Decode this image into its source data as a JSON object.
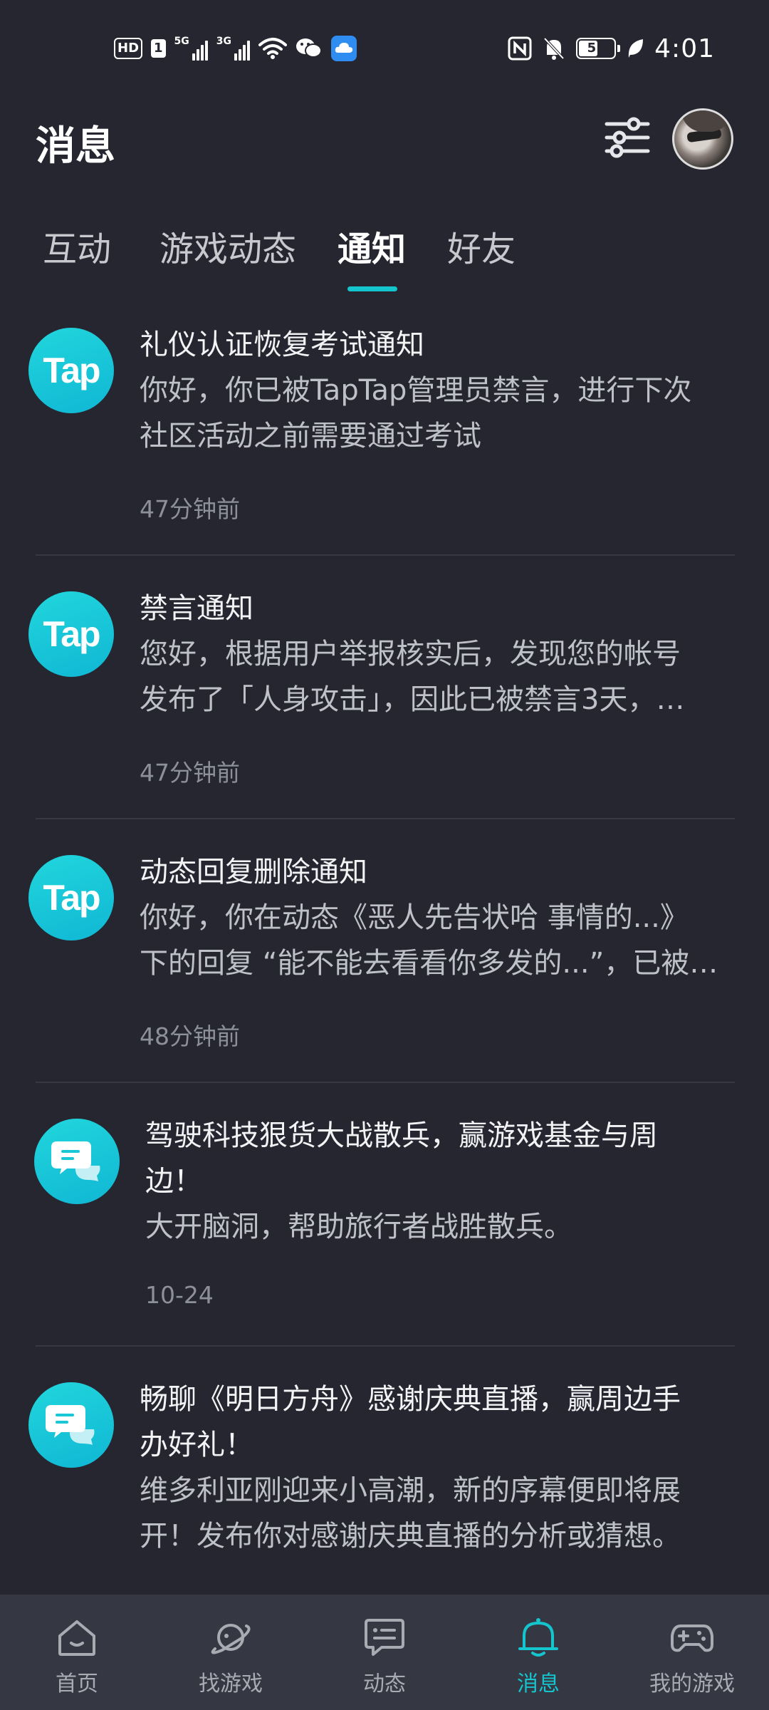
{
  "status_bar": {
    "hd_label": "HD",
    "sim_label": "1",
    "signal1_label": "5G",
    "signal2_label": "3G",
    "battery_level": "51",
    "time": "4:01"
  },
  "header": {
    "title": "消息"
  },
  "tabs": [
    {
      "label": "互动"
    },
    {
      "label": "游戏动态"
    },
    {
      "label": "通知"
    },
    {
      "label": "好友"
    }
  ],
  "messages": [
    {
      "icon": "tap-logo",
      "logo_text": "Tap",
      "title": "礼仪认证恢复考试通知",
      "body_line1": "你好，你已被TapTap管理员禁言，进行下次",
      "body_line2": "社区活动之前需要通过考试",
      "time": "47分钟前"
    },
    {
      "icon": "tap-logo",
      "logo_text": "Tap",
      "title": "禁言通知",
      "body_line1": "您好，根据用户举报核实后，发现您的帐号",
      "body_line2": "发布了「人身攻击」，因此已被禁言3天，…",
      "time": "47分钟前"
    },
    {
      "icon": "tap-logo",
      "logo_text": "Tap",
      "title": "动态回复删除通知",
      "body_line1": "你好，你在动态《恶人先告状哈 事情的...》",
      "body_line2": "下的回复 “能不能去看看你多发的...”，已被…",
      "time": "48分钟前"
    },
    {
      "icon": "chat-bubble-icon",
      "title_line1": "驾驶科技狠货大战散兵，赢游戏基金与周",
      "title_line2": "边！",
      "body_line1": "大开脑洞，帮助旅行者战胜散兵。",
      "time": "10-24"
    },
    {
      "icon": "chat-bubble-icon",
      "title_line1": "畅聊《明日方舟》感谢庆典直播，赢周边手",
      "title_line2": "办好礼！",
      "body_line1": "维多利亚刚迎来小高潮，新的序幕便即将展",
      "body_line2": "开！发布你对感谢庆典直播的分析或猜想。"
    }
  ],
  "bottom_nav": [
    {
      "label": "首页",
      "icon": "home-icon"
    },
    {
      "label": "找游戏",
      "icon": "planet-icon"
    },
    {
      "label": "动态",
      "icon": "message-board-icon"
    },
    {
      "label": "消息",
      "icon": "bell-icon",
      "active": true
    },
    {
      "label": "我的游戏",
      "icon": "gamepad-icon"
    }
  ],
  "colors": {
    "background": "#25262f",
    "accent": "#15c5ce",
    "nav_background": "#353743"
  }
}
